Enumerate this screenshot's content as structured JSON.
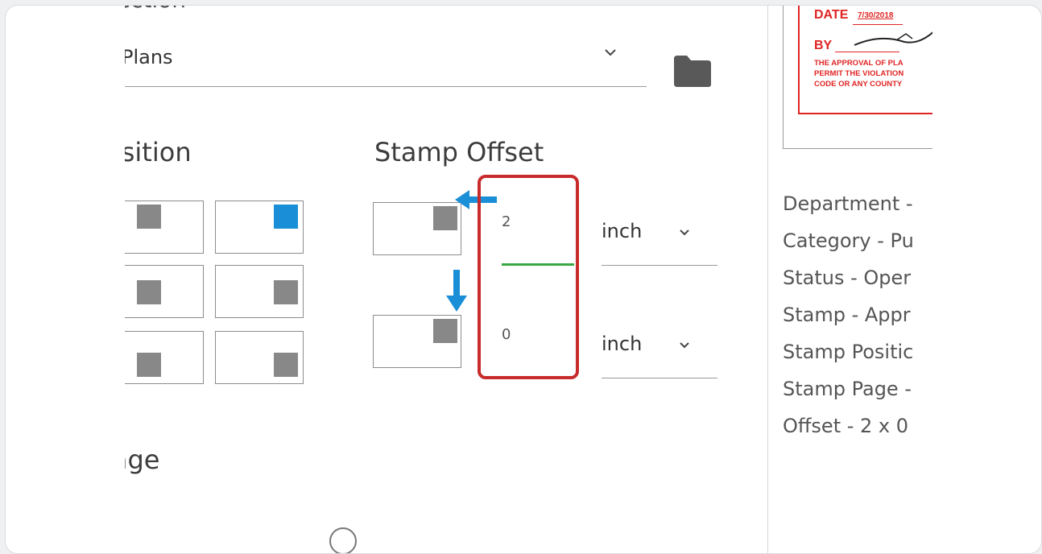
{
  "form": {
    "section_label": "Section",
    "section_value": "Plans",
    "position_heading": "Position",
    "offset_heading": "Stamp Offset",
    "page_heading": "Page",
    "offset_x_value": "2",
    "offset_y_value": "0",
    "unit_x": "inch",
    "unit_y": "inch"
  },
  "stamp_preview": {
    "date_label": "DATE",
    "date_value": "7/30/2018",
    "by_label": "BY",
    "line1": "THE APPROVAL OF PLA",
    "line2": "PERMIT THE VIOLATION",
    "line3": "CODE OR ANY COUNTY"
  },
  "details": [
    "Department -",
    "Category - Pu",
    "Status - Oper",
    "Stamp - Appr",
    "Stamp Positic",
    "Stamp Page -",
    "Offset - 2 x 0"
  ],
  "colors": {
    "accent": "#1a8fd8",
    "highlight": "#c82b2b",
    "focus": "#3aa845",
    "stamp_red": "#e02424"
  },
  "icons": {
    "folder": "folder-icon",
    "chevron": "chevron-down-icon",
    "arrow_left": "arrow-left-icon",
    "arrow_down": "arrow-down-icon"
  }
}
